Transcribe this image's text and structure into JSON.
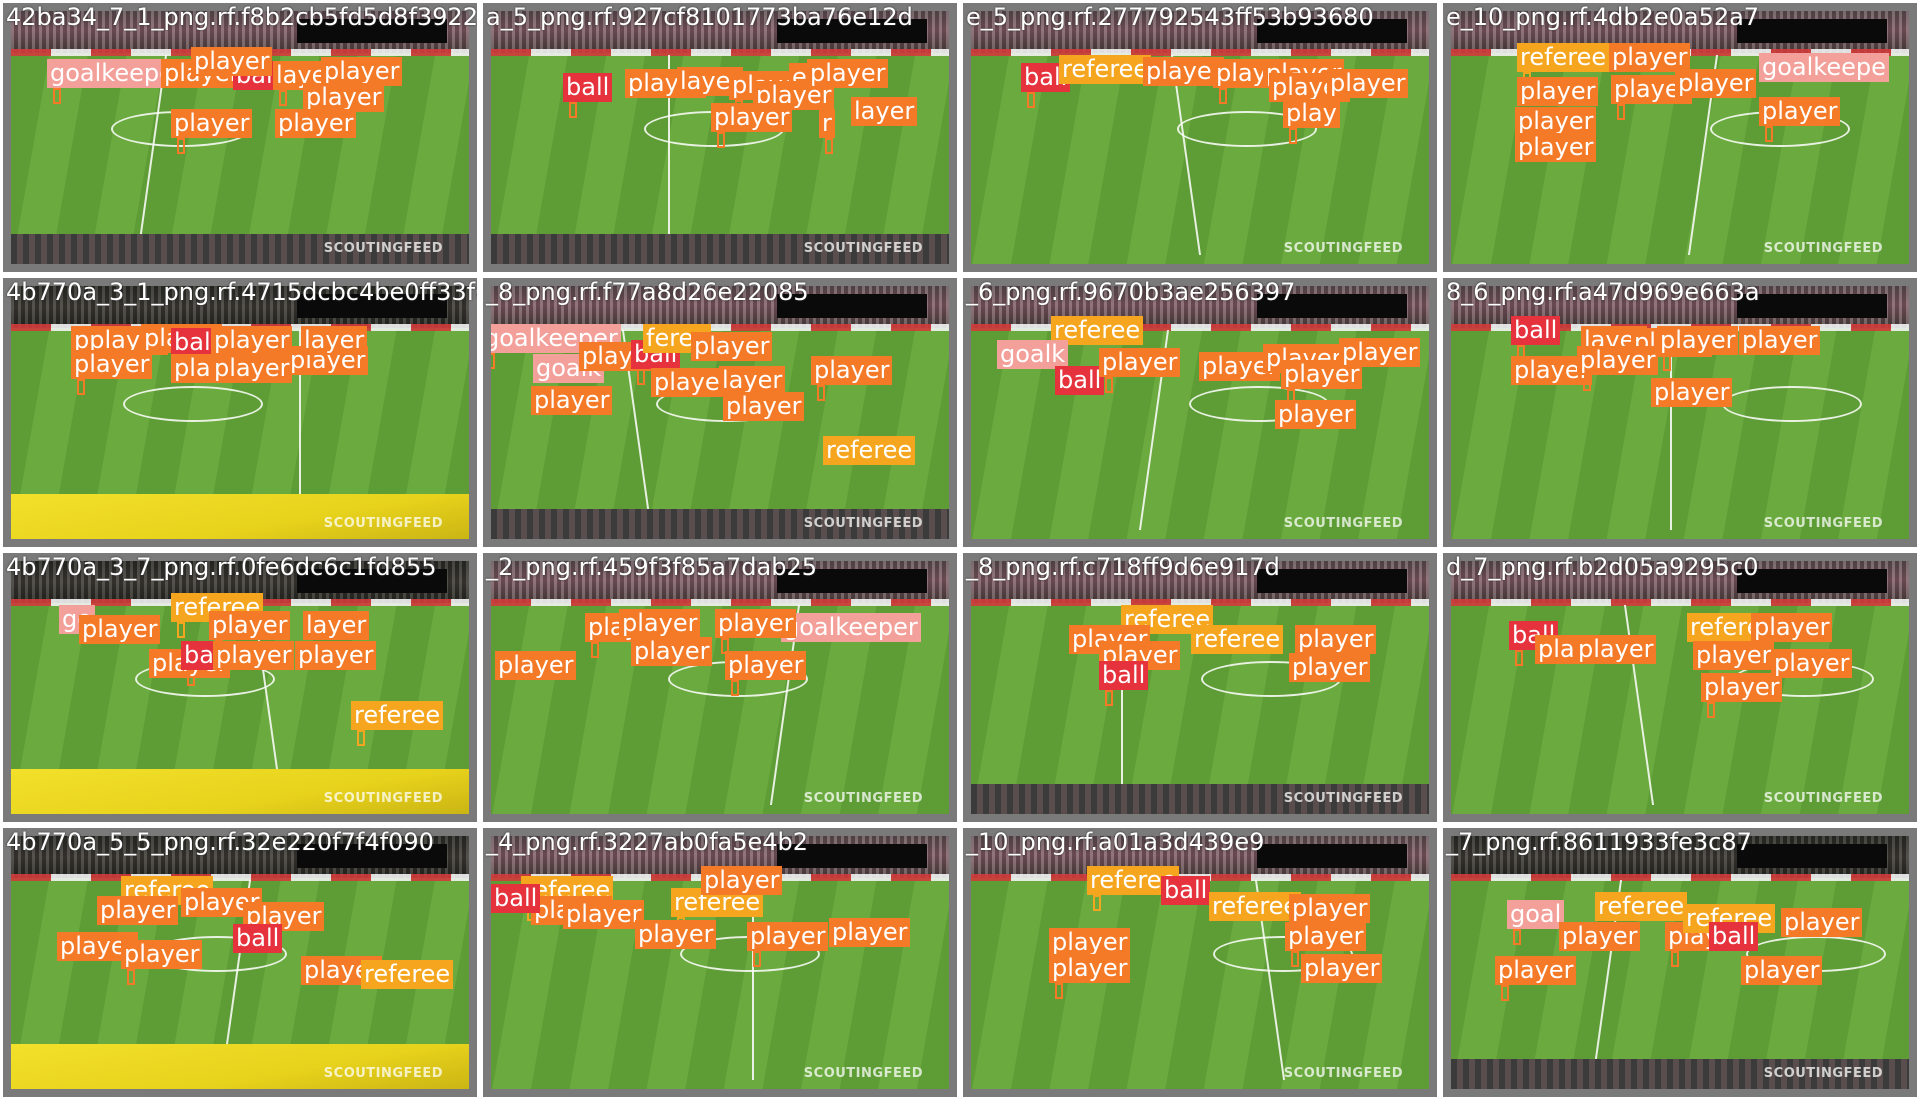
{
  "watermark": "SCOUTINGFEED",
  "class_colors": {
    "player": "#f47a27",
    "referee": "#f6a61e",
    "goalkeeper": "#f4a09a",
    "ball": "#e5323c"
  },
  "tiles": [
    {
      "filename": "42ba34_7_1_png.rf.f8b2cb5fd5d8f39228433",
      "labels": [
        "goalkeepe",
        "player",
        "ball",
        "layer",
        "player",
        "player",
        "player",
        "player",
        "player"
      ]
    },
    {
      "filename": "a_5_png.rf.927cf8101773ba76e12d",
      "labels": [
        "ball",
        "player",
        "layer",
        "player",
        "er",
        "player",
        "player",
        "player",
        "layer",
        "r"
      ]
    },
    {
      "filename": "e_5_png.rf.277792543ff53b93680",
      "labels": [
        "ball",
        "referee",
        "player",
        "player",
        "player",
        "player",
        "play",
        "player"
      ]
    },
    {
      "filename": "e_10_png.rf.4db2e0a52a7",
      "labels": [
        "referee",
        "player",
        "player",
        "player",
        "player",
        "goalkeepe",
        "player",
        "player",
        "player"
      ]
    },
    {
      "filename": "4b770a_3_1_png.rf.4715dcbc4be0ff33f6458",
      "labels": [
        "pplayer",
        "player",
        "ball",
        "player",
        "player",
        "layer",
        "player",
        "player",
        "player"
      ]
    },
    {
      "filename": "_8_png.rf.f77a8d26e22085",
      "labels": [
        "goalkeeper",
        "goalk",
        "player",
        "ball",
        "feree",
        "player",
        "layer",
        "player",
        "player",
        "player",
        "player",
        "referee"
      ]
    },
    {
      "filename": "_6_png.rf.9670b3ae256397",
      "labels": [
        "referee",
        "goalk",
        "ball",
        "player",
        "player",
        "player",
        "player",
        "player",
        "player"
      ]
    },
    {
      "filename": "8_6_png.rf.a47d969e663a",
      "labels": [
        "ball",
        "layer",
        "player",
        "player",
        "player",
        "player",
        "player",
        "player"
      ]
    },
    {
      "filename": "4b770a_3_7_png.rf.0fe6dc6c1fd855",
      "labels": [
        "referee",
        "go",
        "player",
        "player",
        "layer",
        "player",
        "ball",
        "player",
        "player",
        "referee"
      ]
    },
    {
      "filename": "_2_png.rf.459f3f85a7dab25",
      "labels": [
        "player",
        "player",
        "player",
        "player",
        "goalkeeper",
        "player",
        "player"
      ]
    },
    {
      "filename": "_8_png.rf.c718ff9d6e917d",
      "labels": [
        "referee",
        "referee",
        "player",
        "player",
        "player",
        "player",
        "ball"
      ]
    },
    {
      "filename": "d_7_png.rf.b2d05a9295c0",
      "labels": [
        "ball",
        "player",
        "player",
        "referee",
        "player",
        "player",
        "player",
        "player"
      ]
    },
    {
      "filename": "4b770a_5_5_png.rf.32e220f7f4f090",
      "labels": [
        "referee",
        "player",
        "player",
        "player",
        "player",
        "ball",
        "player",
        "player",
        "referee"
      ]
    },
    {
      "filename": "_4_png.rf.3227ab0fa5e4b2",
      "labels": [
        "referee",
        "player",
        "player",
        "referee",
        "player",
        "player",
        "player",
        "player",
        "ball"
      ]
    },
    {
      "filename": "_10_png.rf.a01a3d439e9",
      "labels": [
        "referee",
        "ball",
        "player",
        "player",
        "referee",
        "player",
        "player",
        "player"
      ]
    },
    {
      "filename": "_7_png.rf.8611933fe3c87",
      "labels": [
        "goal",
        "referee",
        "player",
        "player",
        "referee",
        "ball",
        "player",
        "player",
        "player"
      ]
    }
  ]
}
